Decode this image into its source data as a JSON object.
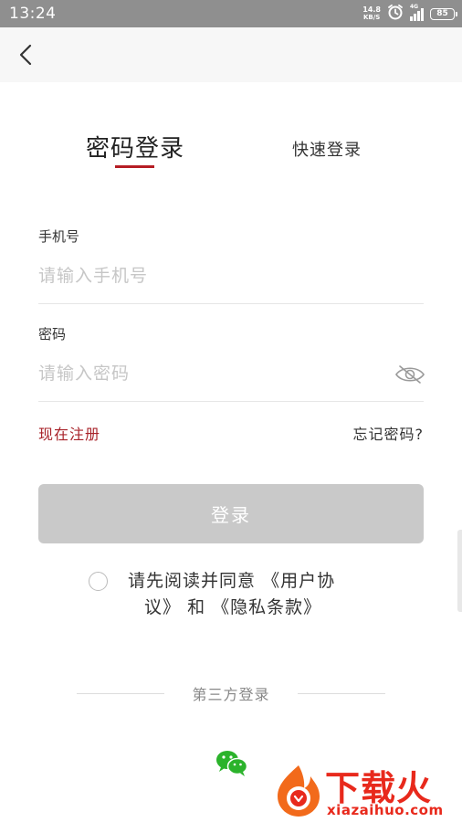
{
  "status_bar": {
    "time": "13:24",
    "net_speed_value": "14.8",
    "net_speed_unit": "KB/S",
    "signal_label": "4G",
    "battery": "85",
    "icons": [
      "alarm-icon",
      "signal-icon",
      "battery-icon"
    ]
  },
  "nav": {
    "back_icon": "chevron-left-icon"
  },
  "tabs": {
    "password_login": "密码登录",
    "quick_login": "快速登录",
    "active": "password_login",
    "accent_color": "#b51d24"
  },
  "form": {
    "phone_label": "手机号",
    "phone_placeholder": "请输入手机号",
    "phone_value": "",
    "password_label": "密码",
    "password_placeholder": "请输入密码",
    "password_value": "",
    "password_toggle_icon": "eye-hidden-icon"
  },
  "links": {
    "register": "现在注册",
    "forgot": "忘记密码?"
  },
  "login_button": {
    "label": "登录",
    "enabled": false
  },
  "agreement": {
    "checked": false,
    "prefix": "请先阅读并同意",
    "user_agreement_part1": "《用户协",
    "user_agreement_part2": "议》",
    "conjunction": "和",
    "privacy_policy": "《隐私条款》"
  },
  "third_party": {
    "title": "第三方登录",
    "providers": [
      "wechat-icon"
    ],
    "wechat_color": "#2bb32b"
  },
  "watermark": {
    "brand_cn": "下载火",
    "brand_en": "xiazaihuo.com",
    "color": "#e8291c"
  }
}
